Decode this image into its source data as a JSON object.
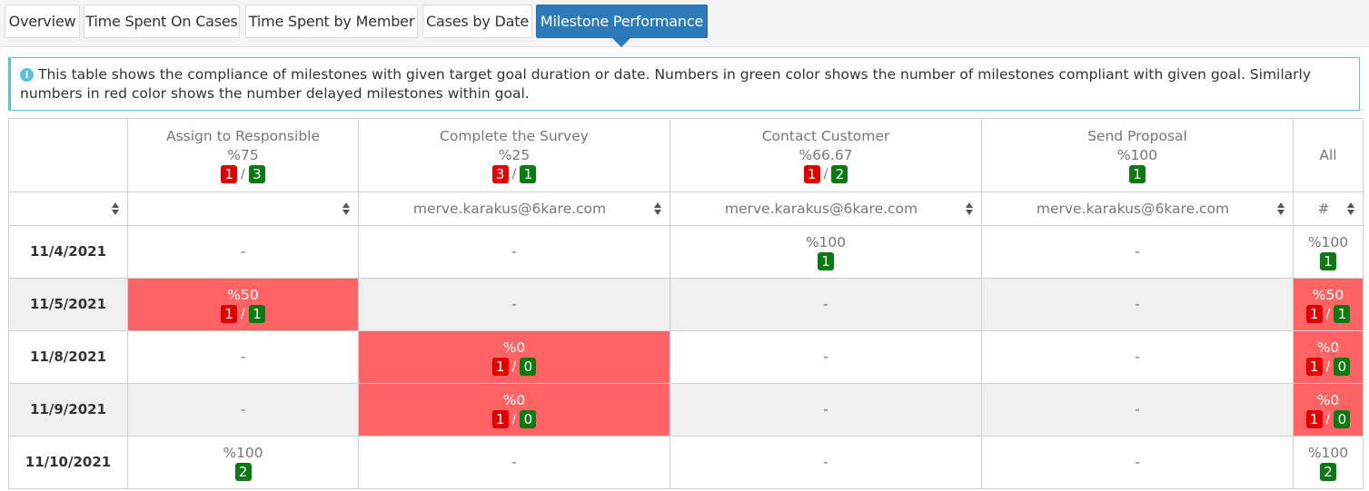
{
  "tabs": [
    {
      "label": "Overview",
      "active": false
    },
    {
      "label": "Time Spent On Cases",
      "active": false
    },
    {
      "label": "Time Spent by Member",
      "active": false
    },
    {
      "label": "Cases by Date",
      "active": false
    },
    {
      "label": "Milestone Performance",
      "active": true
    }
  ],
  "info": {
    "icon": "info-circle-icon",
    "text": "This table shows the compliance of milestones with given target goal duration or date. Numbers in green color shows the number of milestones compliant with given goal. Similarly numbers in red color shows the number delayed milestones within goal."
  },
  "colors": {
    "active_tab": "#2d7ab8",
    "delayed_badge": "#e00000",
    "compliant_badge": "#0b7a12",
    "delayed_cell": "#ff6363",
    "info_border": "#5bc0de"
  },
  "columns": [
    {
      "title": "Assign to Responsible",
      "percent": "%75",
      "delayed": "1",
      "compliant": "3",
      "member": ""
    },
    {
      "title": "Complete the Survey",
      "percent": "%25",
      "delayed": "3",
      "compliant": "1",
      "member": "merve.karakus@6kare.com"
    },
    {
      "title": "Contact Customer",
      "percent": "%66.67",
      "delayed": "1",
      "compliant": "2",
      "member": "merve.karakus@6kare.com"
    },
    {
      "title": "Send Proposal",
      "percent": "%100",
      "delayed": "",
      "compliant": "1",
      "member": "merve.karakus@6kare.com"
    },
    {
      "title": "All",
      "member": "#"
    }
  ],
  "rows": [
    {
      "date": "11/4/2021",
      "cells": [
        {
          "text": "-"
        },
        {
          "text": "-"
        },
        {
          "percent": "%100",
          "compliant": "1"
        },
        {
          "text": "-"
        },
        {
          "percent": "%100",
          "compliant": "1"
        }
      ]
    },
    {
      "date": "11/5/2021",
      "cells": [
        {
          "percent": "%50",
          "delayed": "1",
          "compliant": "1",
          "red": true
        },
        {
          "text": "-"
        },
        {
          "text": "-"
        },
        {
          "text": "-"
        },
        {
          "percent": "%50",
          "delayed": "1",
          "compliant": "1",
          "red": true
        }
      ]
    },
    {
      "date": "11/8/2021",
      "cells": [
        {
          "text": "-"
        },
        {
          "percent": "%0",
          "delayed": "1",
          "compliant": "0",
          "red": true
        },
        {
          "text": "-"
        },
        {
          "text": "-"
        },
        {
          "percent": "%0",
          "delayed": "1",
          "compliant": "0",
          "red": true
        }
      ]
    },
    {
      "date": "11/9/2021",
      "cells": [
        {
          "text": "-"
        },
        {
          "percent": "%0",
          "delayed": "1",
          "compliant": "0",
          "red": true
        },
        {
          "text": "-"
        },
        {
          "text": "-"
        },
        {
          "percent": "%0",
          "delayed": "1",
          "compliant": "0",
          "red": true
        }
      ]
    },
    {
      "date": "11/10/2021",
      "cells": [
        {
          "percent": "%100",
          "compliant": "2"
        },
        {
          "text": "-"
        },
        {
          "text": "-"
        },
        {
          "text": "-"
        },
        {
          "percent": "%100",
          "compliant": "2"
        }
      ]
    }
  ]
}
